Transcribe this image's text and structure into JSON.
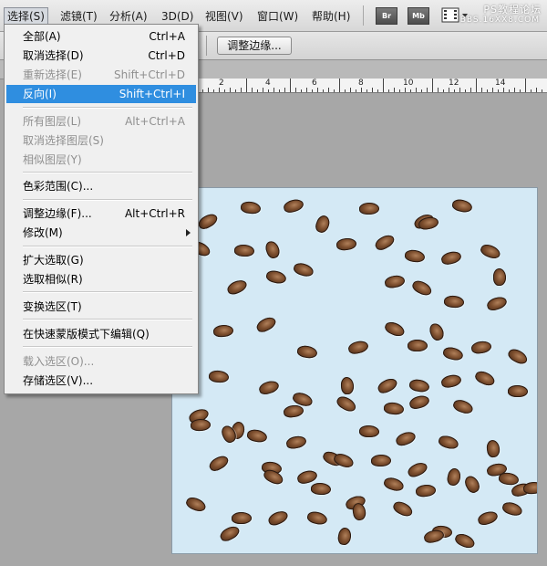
{
  "menubar": {
    "items": [
      {
        "label": "选择(S)"
      },
      {
        "label": "滤镜(T)"
      },
      {
        "label": "分析(A)"
      },
      {
        "label": "3D(D)"
      },
      {
        "label": "视图(V)"
      },
      {
        "label": "窗口(W)"
      },
      {
        "label": "帮助(H)"
      }
    ],
    "app_buttons": [
      "Br",
      "Mb"
    ],
    "watermark_line1": "PS教程论坛",
    "watermark_line2": "BBS.16XX8.COM"
  },
  "options_bar": {
    "refine_edge_label": "调整边缘..."
  },
  "ruler": {
    "labels": [
      "2",
      "4",
      "6",
      "8",
      "10",
      "12",
      "14"
    ]
  },
  "select_menu": {
    "items": [
      {
        "label": "全部(A)",
        "shortcut": "Ctrl+A",
        "state": "enabled"
      },
      {
        "label": "取消选择(D)",
        "shortcut": "Ctrl+D",
        "state": "enabled"
      },
      {
        "label": "重新选择(E)",
        "shortcut": "Shift+Ctrl+D",
        "state": "disabled"
      },
      {
        "label": "反向(I)",
        "shortcut": "Shift+Ctrl+I",
        "state": "highlighted"
      },
      {
        "label": "所有图层(L)",
        "shortcut": "Alt+Ctrl+A",
        "state": "disabled"
      },
      {
        "label": "取消选择图层(S)",
        "shortcut": "",
        "state": "disabled"
      },
      {
        "label": "相似图层(Y)",
        "shortcut": "",
        "state": "disabled"
      },
      {
        "label": "色彩范围(C)...",
        "shortcut": "",
        "state": "enabled"
      },
      {
        "label": "调整边缘(F)...",
        "shortcut": "Alt+Ctrl+R",
        "state": "enabled"
      },
      {
        "label": "修改(M)",
        "shortcut": "",
        "state": "submenu"
      },
      {
        "label": "扩大选取(G)",
        "shortcut": "",
        "state": "enabled"
      },
      {
        "label": "选取相似(R)",
        "shortcut": "",
        "state": "enabled"
      },
      {
        "label": "变换选区(T)",
        "shortcut": "",
        "state": "enabled"
      },
      {
        "label": "在快速蒙版模式下编辑(Q)",
        "shortcut": "",
        "state": "enabled"
      },
      {
        "label": "载入选区(O)...",
        "shortcut": "",
        "state": "disabled"
      },
      {
        "label": "存储选区(V)...",
        "shortcut": "",
        "state": "enabled"
      }
    ]
  },
  "colors": {
    "highlight": "#2f8ee0",
    "canvas": "#d4e9f5",
    "workspace": "#a7a7a7"
  }
}
